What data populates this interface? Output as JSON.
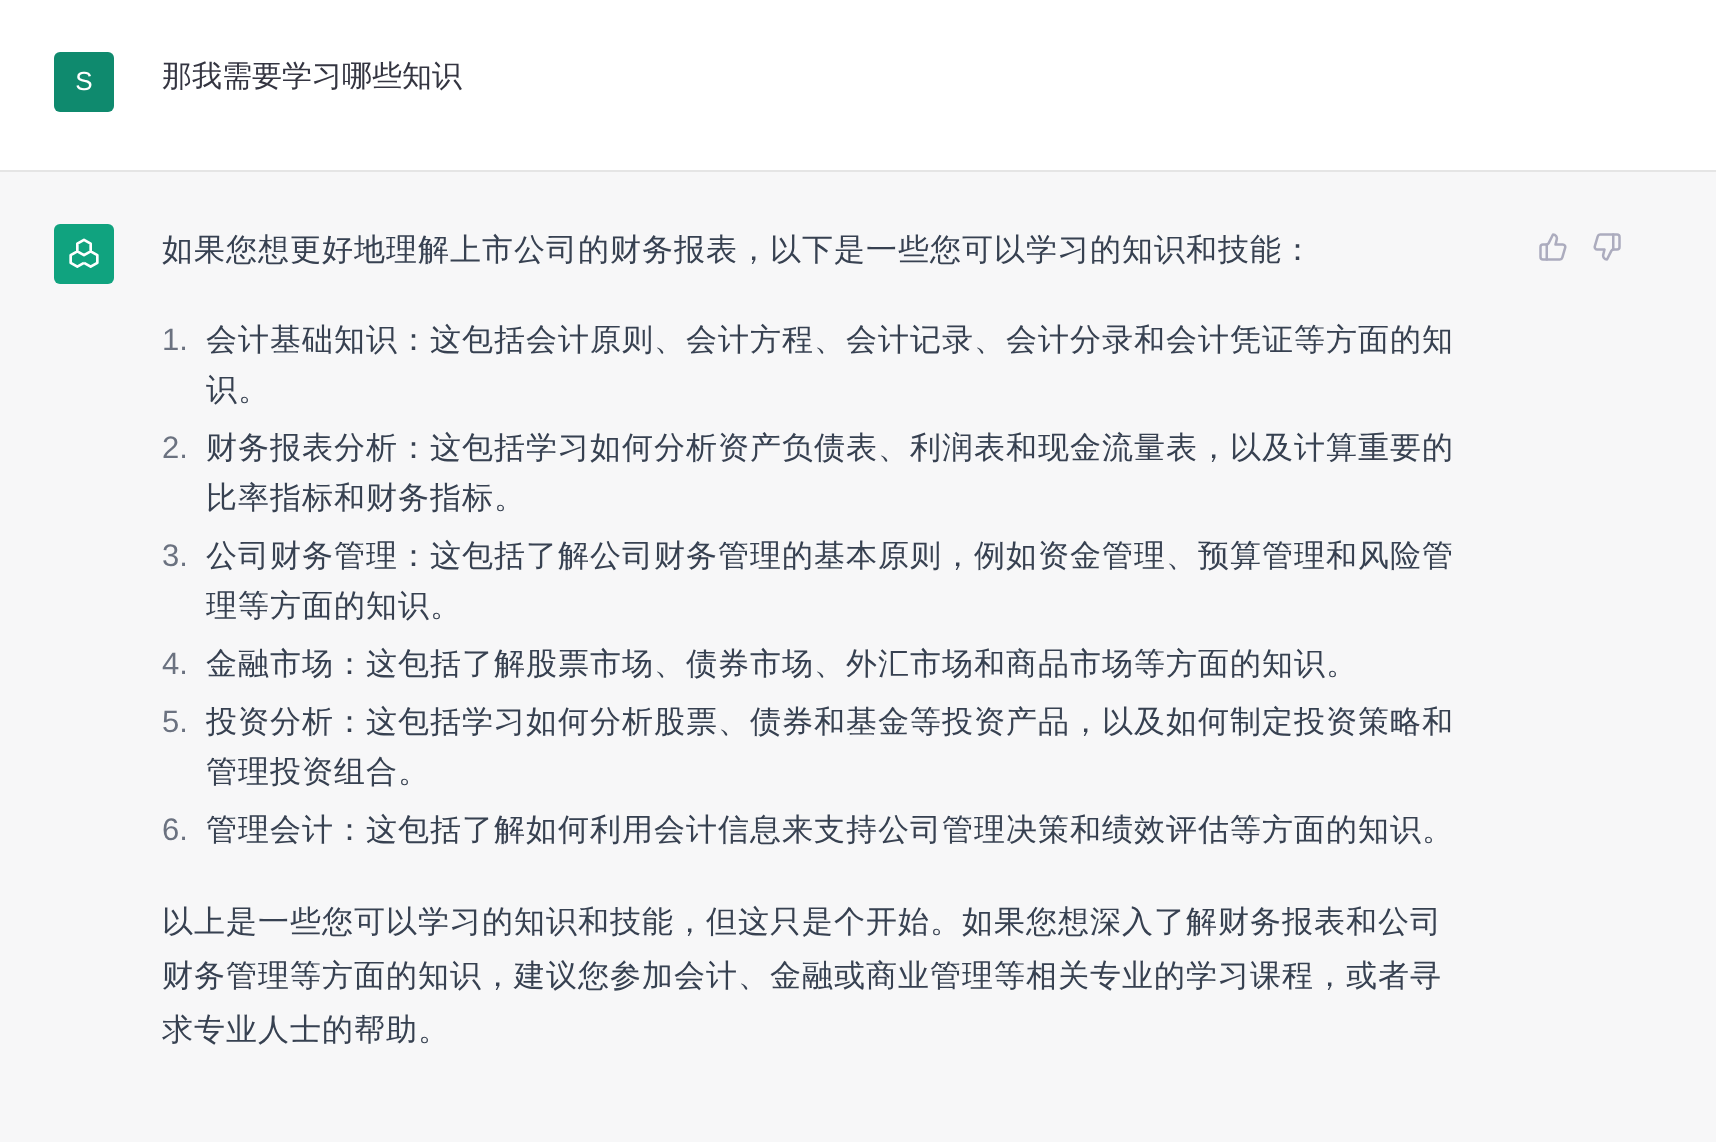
{
  "messages": [
    {
      "kind": "user",
      "avatar": "S",
      "text": "那我需要学习哪些知识"
    },
    {
      "kind": "assistant",
      "intro": "如果您想更好地理解上市公司的财务报表，以下是一些您可以学习的知识和技能：",
      "list": [
        {
          "number": "1.",
          "text": "会计基础知识：这包括会计原则、会计方程、会计记录、会计分录和会计凭证等方面的知识。"
        },
        {
          "number": "2.",
          "text": "财务报表分析：这包括学习如何分析资产负债表、利润表和现金流量表，以及计算重要的比率指标和财务指标。"
        },
        {
          "number": "3.",
          "text": "公司财务管理：这包括了解公司财务管理的基本原则，例如资金管理、预算管理和风险管理等方面的知识。"
        },
        {
          "number": "4.",
          "text": "金融市场：这包括了解股票市场、债券市场、外汇市场和商品市场等方面的知识。"
        },
        {
          "number": "5.",
          "text": "投资分析：这包括学习如何分析股票、债券和基金等投资产品，以及如何制定投资策略和管理投资组合。"
        },
        {
          "number": "6.",
          "text": "管理会计：这包括了解如何利用会计信息来支持公司管理决策和绩效评估等方面的知识。"
        }
      ],
      "outro": "以上是一些您可以学习的知识和技能，但这只是个开始。如果您想深入了解财务报表和公司财务管理等方面的知识，建议您参加会计、金融或商业管理等相关专业的学习课程，或者寻求专业人士的帮助。"
    }
  ]
}
